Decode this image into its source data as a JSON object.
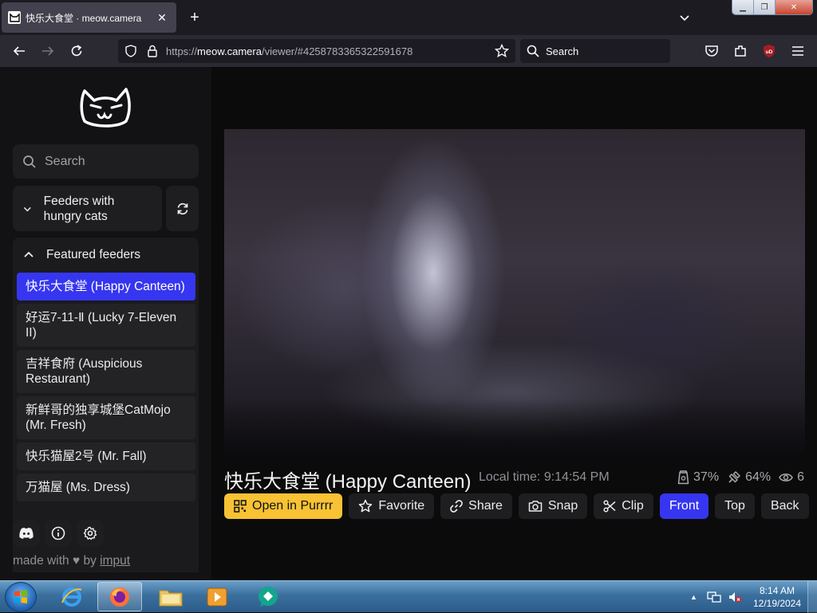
{
  "browser": {
    "tab_title": "快乐大食堂 · meow.camera",
    "url_prefix": "https://",
    "url_host": "meow.camera",
    "url_path": "/viewer/#4258783365322591678",
    "search_placeholder": "Search",
    "extension_badge": "uD"
  },
  "sidebar": {
    "search_placeholder": "Search",
    "hungry_label": "Feeders with hungry cats",
    "featured_label": "Featured feeders",
    "feeders": [
      {
        "label": "快乐大食堂 (Happy Canteen)",
        "active": true
      },
      {
        "label": "好运7-11-Ⅱ (Lucky 7-Eleven II)",
        "active": false
      },
      {
        "label": "吉祥食府 (Auspicious Restaurant)",
        "active": false
      },
      {
        "label": "新鲜哥的独享城堡CatMojo (Mr. Fresh)",
        "active": false
      },
      {
        "label": "快乐猫屋2号 (Mr. Fall)",
        "active": false
      },
      {
        "label": "万猫屋 (Ms. Dress)",
        "active": false
      }
    ],
    "made_with_prefix": "made with",
    "made_with_by": "by",
    "made_with_author": "imput"
  },
  "viewer": {
    "title": "快乐大食堂 (Happy Canteen)",
    "local_time": "Local time: 9:14:54 PM",
    "stats": {
      "food": "37%",
      "battery": "64%",
      "viewers": "6"
    },
    "actions": {
      "open": "Open in Purrrr",
      "favorite": "Favorite",
      "share": "Share",
      "snap": "Snap",
      "clip": "Clip",
      "front": "Front",
      "top": "Top",
      "back": "Back"
    }
  },
  "taskbar": {
    "time": "8:14 AM",
    "date": "12/19/2024"
  },
  "colors": {
    "accent_blue": "#3636f0",
    "accent_yellow": "#f7c234",
    "background": "#0b0b0c"
  }
}
